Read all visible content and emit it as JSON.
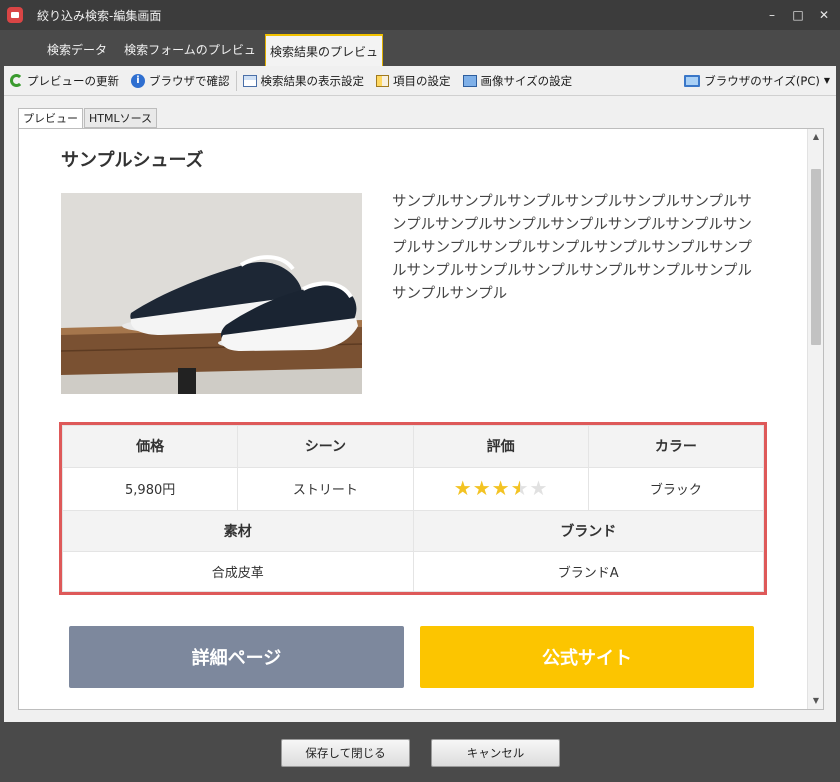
{
  "window": {
    "title": "絞り込み検索-編集画面",
    "minimize": "–",
    "maximize": "□",
    "close": "✕"
  },
  "tabs": [
    {
      "label": "検索データ"
    },
    {
      "label": "検索フォームのプレビュー"
    },
    {
      "label": "検索結果のプレビュー"
    }
  ],
  "toolbar": {
    "refresh": "プレビューの更新",
    "browser_check": "ブラウザで確認",
    "display_settings": "検索結果の表示設定",
    "field_settings": "項目の設定",
    "image_size": "画像サイズの設定",
    "browser_size": "ブラウザのサイズ(PC)"
  },
  "subtabs": [
    {
      "label": "プレビュー"
    },
    {
      "label": "HTMLソース"
    }
  ],
  "preview": {
    "title": "サンプルシューズ",
    "description": "サンプルサンプルサンプルサンプルサンプルサンプルサンプルサンプルサンプルサンプルサンプルサンプルサンプルサンプルサンプルサンプルサンプルサンプルサンプルサンプルサンプルサンプルサンプルサンプルサンプルサンプルサンプル",
    "specs": {
      "price_label": "価格",
      "price": "5,980円",
      "scene_label": "シーン",
      "scene": "ストリート",
      "rating_label": "評価",
      "rating": 3.5,
      "rating_max": 5,
      "color_label": "カラー",
      "color": "ブラック",
      "material_label": "素材",
      "material": "合成皮革",
      "brand_label": "ブランド",
      "brand": "ブランドA"
    },
    "buttons": {
      "detail": "詳細ページ",
      "official": "公式サイト"
    }
  },
  "footer": {
    "save": "保存して閉じる",
    "cancel": "キャンセル"
  },
  "colors": {
    "titlebar": "#3c3c3c",
    "active_tab_accent": "#f2c200",
    "table_border": "#de5959",
    "detail_button": "#7d889d",
    "official_button": "#fcc500",
    "star": "#f3c323"
  }
}
